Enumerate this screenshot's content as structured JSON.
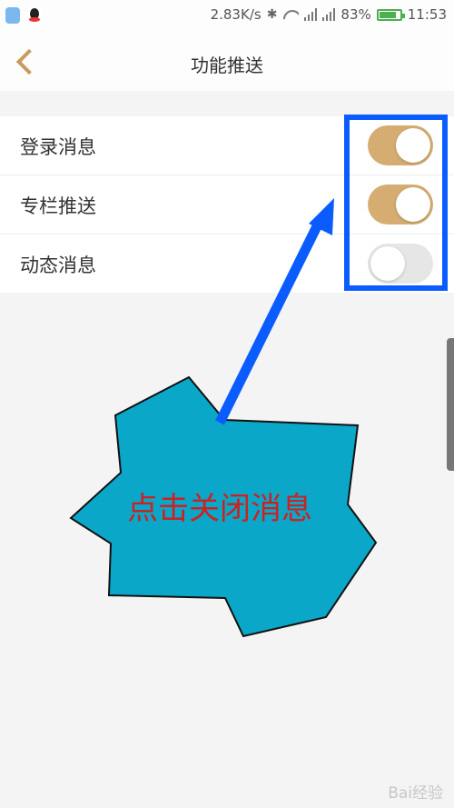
{
  "status_bar": {
    "speed": "2.83K/s",
    "battery_percent": "83%",
    "battery_level": 0.83,
    "time": "11:53",
    "icons": [
      "shield-app-icon",
      "qq-icon",
      "bluetooth-icon",
      "wifi-icon",
      "signal-icon",
      "battery-icon"
    ]
  },
  "header": {
    "title": "功能推送",
    "back_icon": "chevron-left-icon",
    "accent_color": "#c89a5d"
  },
  "settings": [
    {
      "label": "登录消息",
      "enabled": true
    },
    {
      "label": "专栏推送",
      "enabled": true
    },
    {
      "label": "动态消息",
      "enabled": false
    }
  ],
  "toggle_colors": {
    "on": "#d5ad72",
    "off": "#e6e6e6"
  },
  "annotation": {
    "callout_text": "点击关闭消息",
    "box_color": "#0a5cff",
    "callout_fill": "#0aa7c9",
    "text_color": "#cc2222"
  },
  "watermark": "Bai经验"
}
